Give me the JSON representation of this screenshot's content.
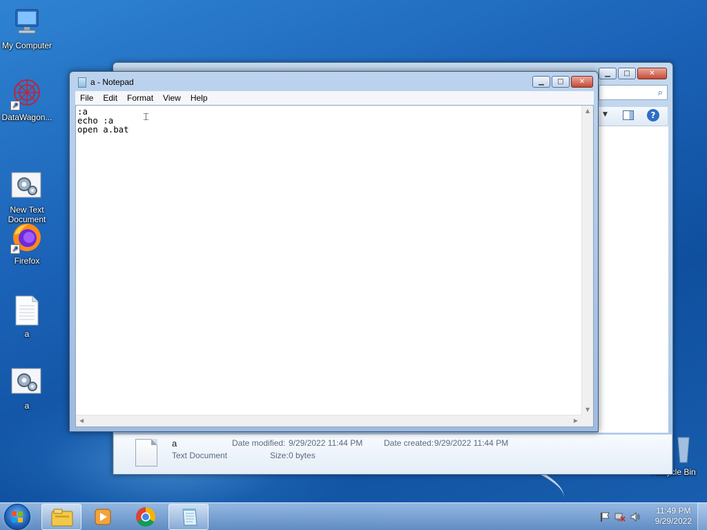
{
  "desktop": {
    "icons": [
      {
        "label": "My Computer",
        "icon": "computer-icon"
      },
      {
        "label": "DataWagon...",
        "icon": "datawagon-icon"
      },
      {
        "label": "New Text\nDocument",
        "icon": "batch-file-icon"
      },
      {
        "label": "Firefox",
        "icon": "firefox-icon"
      },
      {
        "label": "a",
        "icon": "text-file-icon"
      },
      {
        "label": "a",
        "icon": "batch-file-icon"
      }
    ],
    "recycle_bin_label": "Recycle Bin"
  },
  "explorer": {
    "details": {
      "name": "a",
      "type": "Text Document",
      "date_modified_label": "Date modified:",
      "date_modified": "9/29/2022 11:44 PM",
      "date_created_label": "Date created:",
      "date_created": "9/29/2022 11:44 PM",
      "size_label": "Size:",
      "size": "0 bytes"
    }
  },
  "notepad": {
    "title": "a - Notepad",
    "menu": [
      "File",
      "Edit",
      "Format",
      "View",
      "Help"
    ],
    "content": ":a\necho :a\nopen a.bat"
  },
  "taskbar": {
    "pinned": [
      "windows-explorer-icon",
      "media-player-icon",
      "chrome-icon",
      "notepad-icon"
    ],
    "clock_time": "11:49 PM",
    "clock_date": "9/29/2022"
  }
}
